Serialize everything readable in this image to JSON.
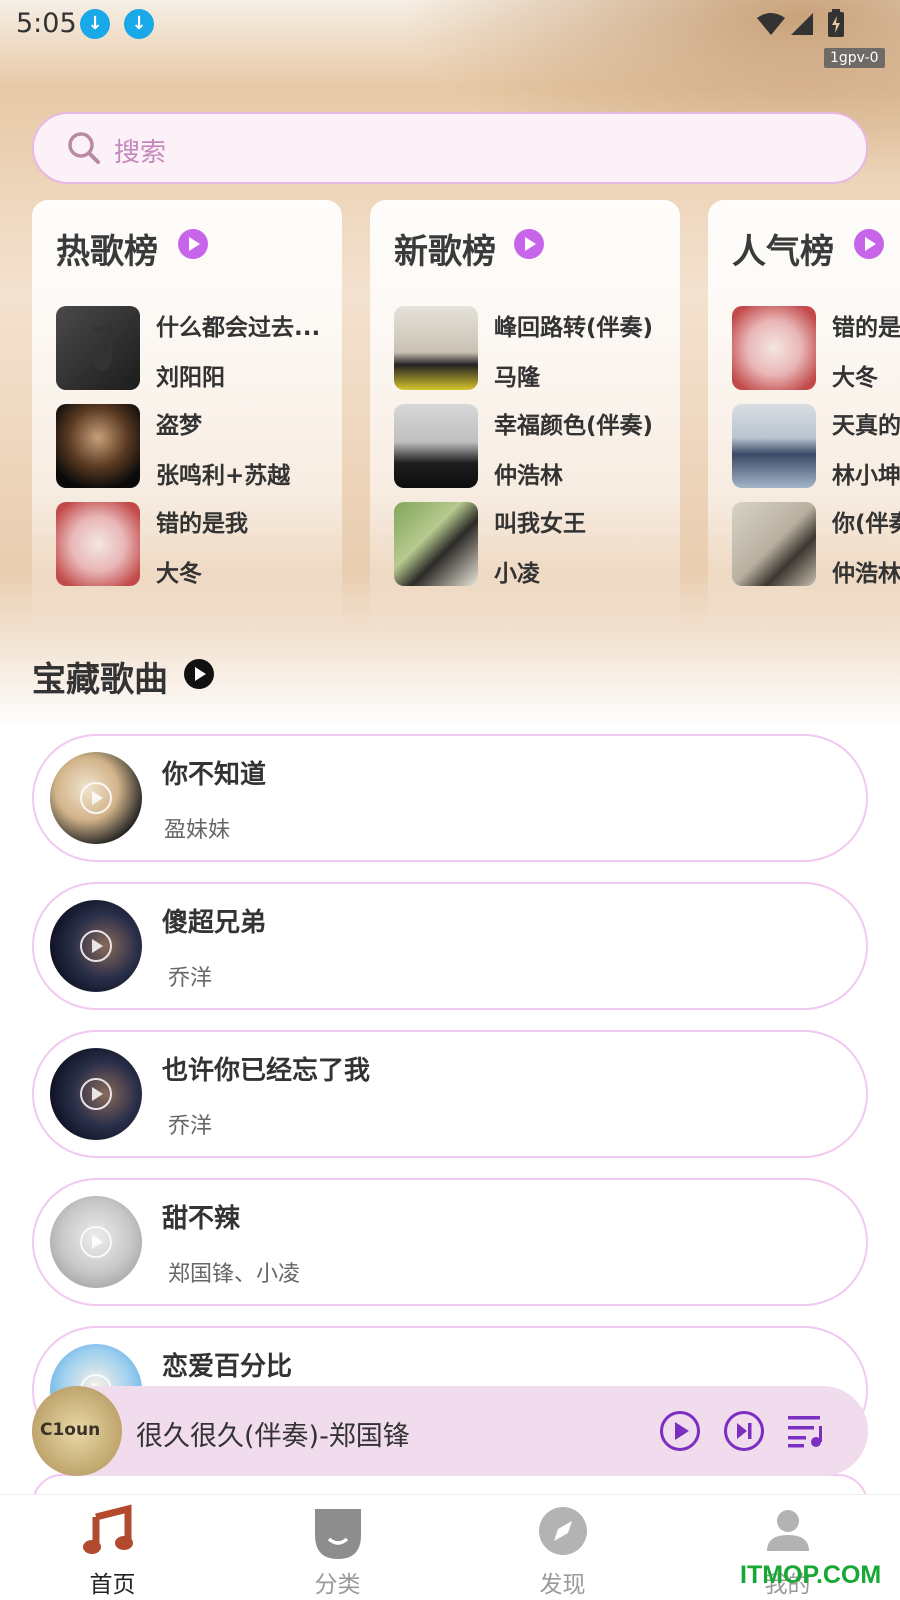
{
  "status_bar": {
    "time": "5:05",
    "network_badge": "1gpv-0"
  },
  "search": {
    "placeholder": "搜索"
  },
  "rank_cards": [
    {
      "title": "热歌榜",
      "items": [
        {
          "song": "什么都会过去...",
          "artist": "刘阳阳"
        },
        {
          "song": "盗梦",
          "artist": "张鸣利+苏越"
        },
        {
          "song": "错的是我",
          "artist": "大冬"
        }
      ]
    },
    {
      "title": "新歌榜",
      "items": [
        {
          "song": "峰回路转(伴奏)",
          "artist": "马隆"
        },
        {
          "song": "幸福颜色(伴奏)",
          "artist": "仲浩林"
        },
        {
          "song": "叫我女王",
          "artist": "小凌"
        }
      ]
    },
    {
      "title": "人气榜",
      "items": [
        {
          "song": "错的是",
          "artist": "大冬"
        },
        {
          "song": "天真的",
          "artist": "林小坤"
        },
        {
          "song": "你(伴奏",
          "artist": "仲浩林"
        }
      ]
    }
  ],
  "treasure": {
    "title": "宝藏歌曲",
    "songs": [
      {
        "title": "你不知道",
        "artist": "盈妹妹"
      },
      {
        "title": "傻超兄弟",
        "artist": "乔洋"
      },
      {
        "title": "也许你已经忘了我",
        "artist": "乔洋"
      },
      {
        "title": "甜不辣",
        "artist": "郑国锋、小凌"
      },
      {
        "title": "恋爱百分比",
        "artist": ""
      }
    ]
  },
  "mini_player": {
    "title": "很久很久(伴奏)-郑国锋",
    "cover_text": "C1oun"
  },
  "bottom_nav": [
    {
      "label": "首页",
      "active": true
    },
    {
      "label": "分类",
      "active": false
    },
    {
      "label": "发现",
      "active": false
    },
    {
      "label": "我的",
      "active": false
    }
  ],
  "watermark": "ITMOP.COM",
  "colors": {
    "accent_purple": "#c765ea",
    "player_icon": "#7a2fc0",
    "card_border": "#f0c8f0",
    "search_bg": "#fdf1f8"
  }
}
